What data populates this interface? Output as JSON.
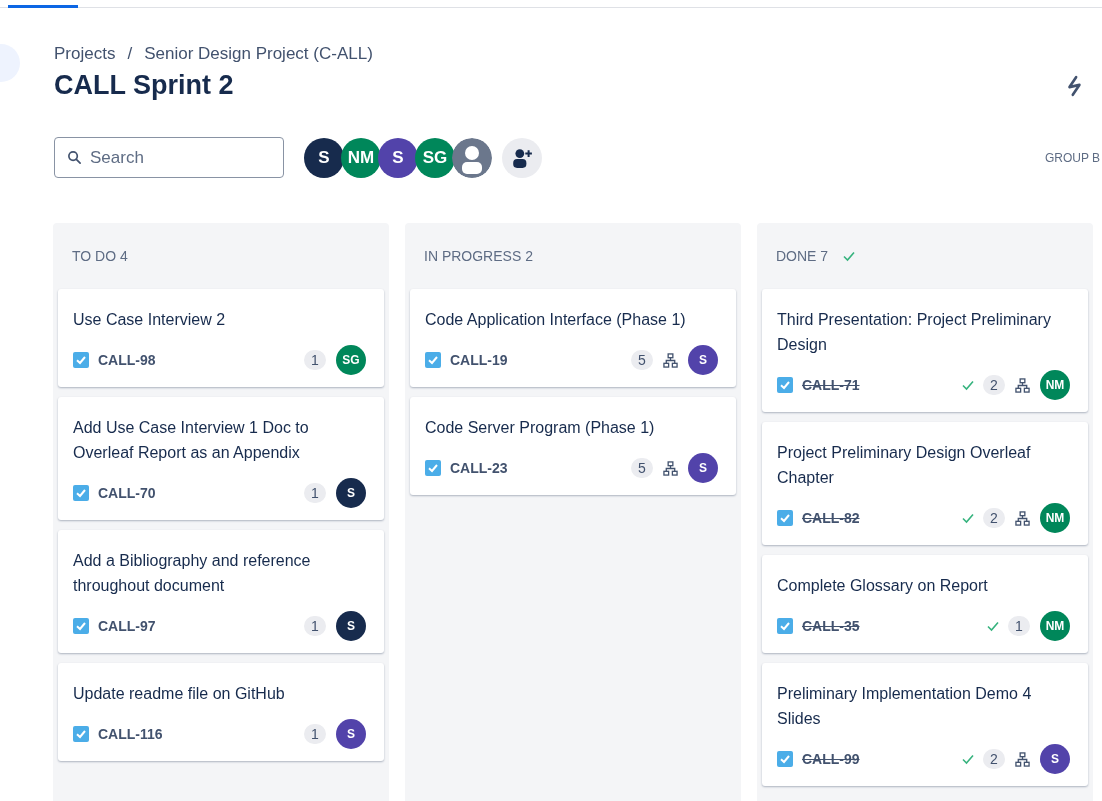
{
  "top_tabs": [
    {
      "selected": true
    }
  ],
  "breadcrumbs": [
    "Projects",
    "Senior Design Project (C-ALL)"
  ],
  "breadcrumb_separator": "/",
  "title": "CALL Sprint 2",
  "search": {
    "placeholder": "Search"
  },
  "people": [
    {
      "kind": "initials",
      "initials": "S",
      "color": "#172b4d"
    },
    {
      "kind": "initials",
      "initials": "NM",
      "color": "#00875a"
    },
    {
      "kind": "initials",
      "initials": "S",
      "color": "#5243aa"
    },
    {
      "kind": "initials",
      "initials": "SG",
      "color": "#00875a"
    },
    {
      "kind": "placeholder",
      "color": "#6b778c"
    }
  ],
  "group_by": "GROUP B",
  "columns": [
    {
      "title": "TO DO 4",
      "done": false,
      "cards": [
        {
          "title": "Use Case Interview 2",
          "key": "CALL-98",
          "resolved": false,
          "estimate": "1",
          "subtasks": false,
          "assignee": {
            "initials": "SG",
            "color": "#00875a"
          }
        },
        {
          "title": "Add Use Case Interview 1 Doc to Overleaf Report as an Appendix",
          "key": "CALL-70",
          "resolved": false,
          "estimate": "1",
          "subtasks": false,
          "assignee": {
            "initials": "S",
            "color": "#172b4d"
          }
        },
        {
          "title": "Add a Bibliography and reference throughout document",
          "key": "CALL-97",
          "resolved": false,
          "estimate": "1",
          "subtasks": false,
          "assignee": {
            "initials": "S",
            "color": "#172b4d"
          }
        },
        {
          "title": "Update readme file on GitHub",
          "key": "CALL-116",
          "resolved": false,
          "estimate": "1",
          "subtasks": false,
          "assignee": {
            "initials": "S",
            "color": "#5243aa"
          }
        }
      ]
    },
    {
      "title": "IN PROGRESS 2",
      "done": false,
      "cards": [
        {
          "title": "Code Application Interface (Phase 1)",
          "key": "CALL-19",
          "resolved": false,
          "estimate": "5",
          "subtasks": true,
          "assignee": {
            "initials": "S",
            "color": "#5243aa"
          }
        },
        {
          "title": "Code Server Program (Phase 1)",
          "key": "CALL-23",
          "resolved": false,
          "estimate": "5",
          "subtasks": true,
          "assignee": {
            "initials": "S",
            "color": "#5243aa"
          }
        }
      ]
    },
    {
      "title": "DONE 7",
      "done": true,
      "cards": [
        {
          "title": "Third Presentation: Project Preliminary Design",
          "key": "CALL-71",
          "resolved": true,
          "estimate": "2",
          "subtasks": true,
          "assignee": {
            "initials": "NM",
            "color": "#00875a"
          }
        },
        {
          "title": "Project Preliminary Design Overleaf Chapter",
          "key": "CALL-82",
          "resolved": true,
          "estimate": "2",
          "subtasks": true,
          "assignee": {
            "initials": "NM",
            "color": "#00875a"
          }
        },
        {
          "title": "Complete Glossary on Report",
          "key": "CALL-35",
          "resolved": true,
          "estimate": "1",
          "subtasks": false,
          "assignee": {
            "initials": "NM",
            "color": "#00875a"
          }
        },
        {
          "title": "Preliminary Implementation Demo 4 Slides",
          "key": "CALL-99",
          "resolved": true,
          "estimate": "2",
          "subtasks": true,
          "assignee": {
            "initials": "S",
            "color": "#5243aa"
          }
        }
      ]
    }
  ]
}
